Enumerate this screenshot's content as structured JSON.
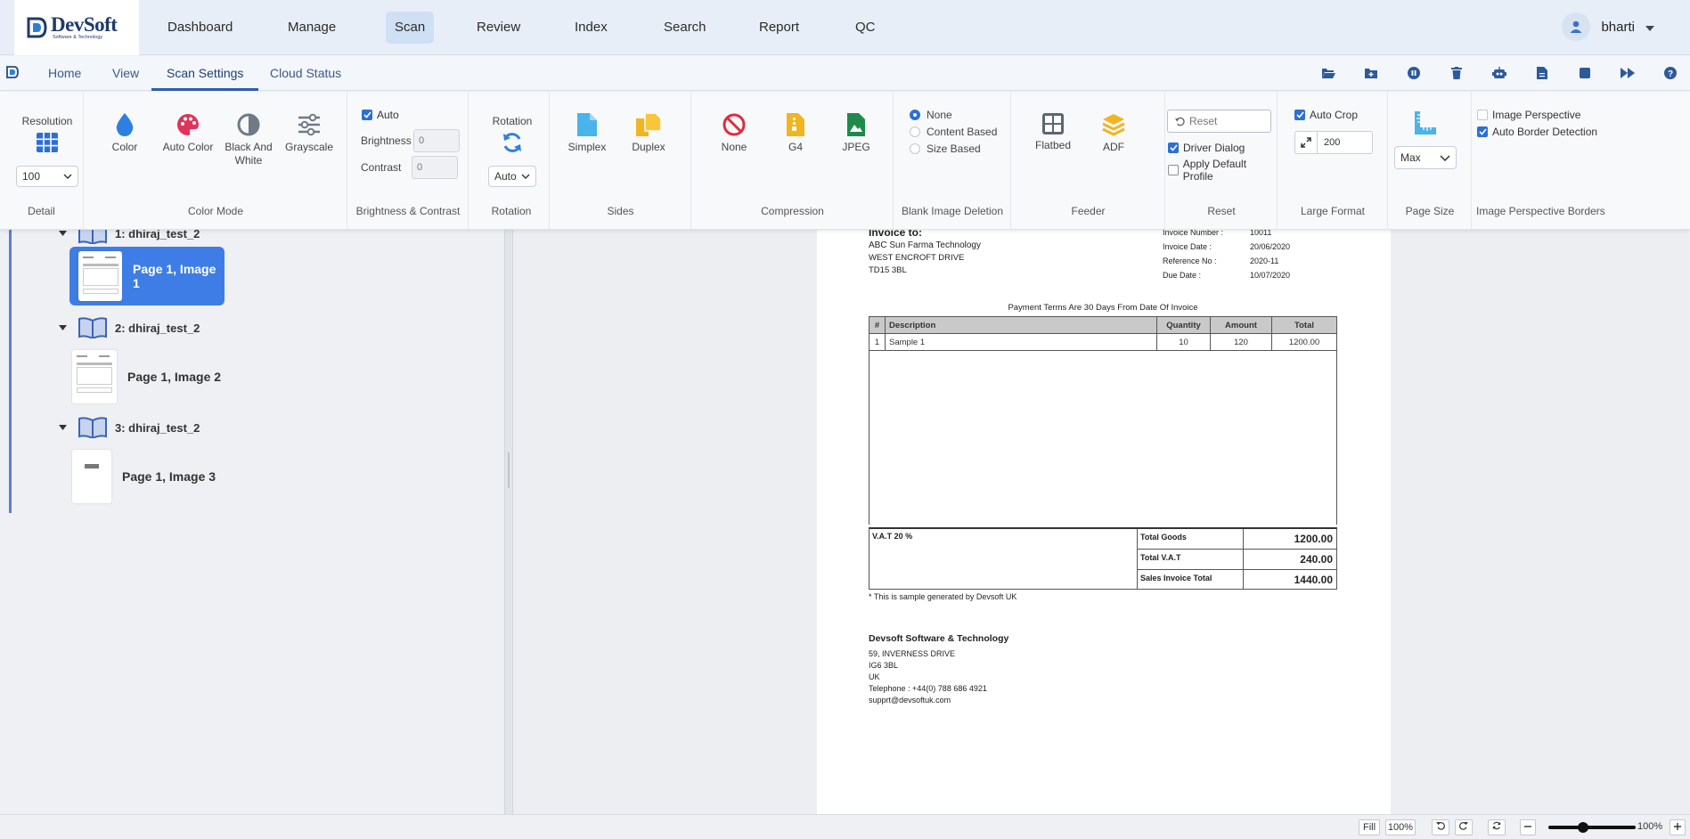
{
  "app": {
    "logo_text": "DevSoft",
    "logo_tagline": "Software & Technology"
  },
  "nav": {
    "items": [
      "Dashboard",
      "Manage",
      "Scan",
      "Review",
      "Index",
      "Search",
      "Report",
      "QC"
    ],
    "active": "Scan",
    "user": "bharti"
  },
  "tabs": {
    "items": [
      "Home",
      "View",
      "Scan Settings",
      "Cloud Status"
    ],
    "active": "Scan Settings",
    "toolbar_icons": [
      "open-folder-icon",
      "new-folder-icon",
      "pause-icon",
      "delete-icon",
      "robot-icon",
      "document-icon",
      "stop-icon",
      "fast-forward-icon",
      "help-icon"
    ]
  },
  "ribbon": {
    "detail": {
      "title": "Resolution",
      "value": "100",
      "label": "Detail"
    },
    "color_mode": {
      "buttons": [
        "Color",
        "Auto Color",
        "Black And White",
        "Grayscale"
      ],
      "label": "Color Mode"
    },
    "brightness_contrast": {
      "auto_label": "Auto",
      "auto_checked": true,
      "brightness_label": "Brightness",
      "brightness_value": "0",
      "contrast_label": "Contrast",
      "contrast_value": "0",
      "label": "Brightness & Contrast"
    },
    "rotation": {
      "title": "Rotation",
      "value": "Auto",
      "label": "Rotation"
    },
    "sides": {
      "buttons": [
        "Simplex",
        "Duplex"
      ],
      "label": "Sides"
    },
    "compression": {
      "buttons": [
        "None",
        "G4",
        "JPEG"
      ],
      "label": "Compression"
    },
    "blank_image": {
      "options": [
        "None",
        "Content Based",
        "Size Based"
      ],
      "selected": "None",
      "label": "Blank Image Deletion"
    },
    "feeder": {
      "buttons": [
        "Flatbed",
        "ADF"
      ],
      "label": "Feeder"
    },
    "reset": {
      "button": "Reset",
      "driver_dialog": "Driver Dialog",
      "driver_dialog_checked": true,
      "apply_default": "Apply Default Profile",
      "apply_default_checked": false,
      "label": "Reset"
    },
    "large_format": {
      "auto_crop": "Auto Crop",
      "auto_crop_checked": true,
      "size_value": "200",
      "label": "Large Format"
    },
    "page_size": {
      "value": "Max",
      "label": "Page Size"
    },
    "perspective": {
      "image_perspective": "Image Perspective",
      "image_perspective_checked": false,
      "auto_border": "Auto Border Detection",
      "auto_border_checked": true,
      "label": "Image Perspective Borders"
    }
  },
  "tree": {
    "batches": [
      {
        "name": "1: dhiraj_test_2",
        "page": "Page 1, Image 1",
        "selected": true
      },
      {
        "name": "2: dhiraj_test_2",
        "page": "Page 1, Image 2",
        "selected": false
      },
      {
        "name": "3: dhiraj_test_2",
        "page": "Page 1, Image 3",
        "selected": false
      }
    ]
  },
  "invoice": {
    "to_heading": "Invoice to:",
    "to_lines": [
      "ABC Sun Farma Technology",
      "WEST ENCROFT DRIVE",
      "TD15 3BL"
    ],
    "meta": [
      {
        "label": "Invoice Number :",
        "value": "10011"
      },
      {
        "label": "Invoice Date :",
        "value": "20/06/2020"
      },
      {
        "label": "Reference No :",
        "value": "2020-11"
      },
      {
        "label": "Due Date :",
        "value": "10/07/2020"
      }
    ],
    "terms": "Payment Terms Are 30 Days From Date Of Invoice",
    "columns": [
      "#",
      "Description",
      "Quantity",
      "Amount",
      "Total"
    ],
    "rows": [
      [
        "1",
        "Sample 1",
        "10",
        "120",
        "1200.00"
      ]
    ],
    "vat_label": "V.A.T 20 %",
    "totals": [
      {
        "label": "Total Goods",
        "value": "1200.00"
      },
      {
        "label": "Total V.A.T",
        "value": "240.00"
      },
      {
        "label": "Sales Invoice Total",
        "value": "1440.00"
      }
    ],
    "note": "* This is sample generated by Devsoft UK",
    "company": "Devsoft Software & Technology",
    "address": [
      "59, INVERNESS DRIVE",
      "IG6 3BL",
      "UK",
      "Telephone : +44(0) 788 686 4921",
      "supprt@devsoftuk.com"
    ]
  },
  "status": {
    "fill": "Fill",
    "hundred": "100%",
    "zoom": "100%",
    "zoom_fraction": 0.4
  }
}
